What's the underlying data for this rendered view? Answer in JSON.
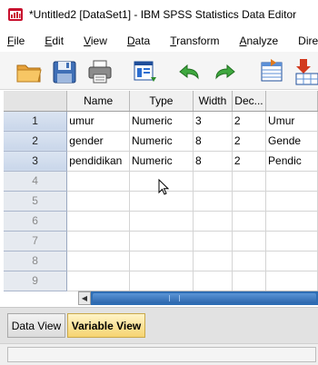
{
  "window": {
    "title": "*Untitled2 [DataSet1] - IBM SPSS Statistics Data Editor",
    "icon": "spss-app-icon"
  },
  "menu": [
    {
      "label": "File",
      "mnemonic": "F",
      "rest": "ile"
    },
    {
      "label": "Edit",
      "mnemonic": "E",
      "rest": "dit"
    },
    {
      "label": "View",
      "mnemonic": "V",
      "rest": "iew"
    },
    {
      "label": "Data",
      "mnemonic": "D",
      "rest": "ata"
    },
    {
      "label": "Transform",
      "mnemonic": "T",
      "rest": "ransform"
    },
    {
      "label": "Analyze",
      "mnemonic": "A",
      "rest": "nalyze"
    },
    {
      "label": "Direc",
      "mnemonic": "",
      "rest": "Direc"
    }
  ],
  "toolbar": {
    "buttons": [
      "open-folder-icon",
      "save-disk-icon",
      "print-icon",
      "dialog-recall-icon",
      "undo-icon",
      "redo-icon",
      "go-to-case-icon",
      "go-to-variable-icon"
    ]
  },
  "grid": {
    "columns": [
      "Name",
      "Type",
      "Width",
      "Dec...",
      ""
    ],
    "rows": [
      {
        "num": "1",
        "cells": [
          "umur",
          "Numeric",
          "3",
          "2",
          "Umur"
        ]
      },
      {
        "num": "2",
        "cells": [
          "gender",
          "Numeric",
          "8",
          "2",
          "Gende"
        ]
      },
      {
        "num": "3",
        "cells": [
          "pendidikan",
          "Numeric",
          "8",
          "2",
          "Pendic"
        ]
      },
      {
        "num": "4",
        "cells": [
          "",
          "",
          "",
          "",
          ""
        ]
      },
      {
        "num": "5",
        "cells": [
          "",
          "",
          "",
          "",
          ""
        ]
      },
      {
        "num": "6",
        "cells": [
          "",
          "",
          "",
          "",
          ""
        ]
      },
      {
        "num": "7",
        "cells": [
          "",
          "",
          "",
          "",
          ""
        ]
      },
      {
        "num": "8",
        "cells": [
          "",
          "",
          "",
          "",
          ""
        ]
      },
      {
        "num": "9",
        "cells": [
          "",
          "",
          "",
          "",
          ""
        ]
      }
    ]
  },
  "tabs": {
    "data_view": "Data View",
    "variable_view": "Variable View",
    "active": "Variable View"
  },
  "colors": {
    "active_tab": "#f6d470",
    "scrollbar": "#2e6db4",
    "row_header": "#c9d6ea"
  }
}
